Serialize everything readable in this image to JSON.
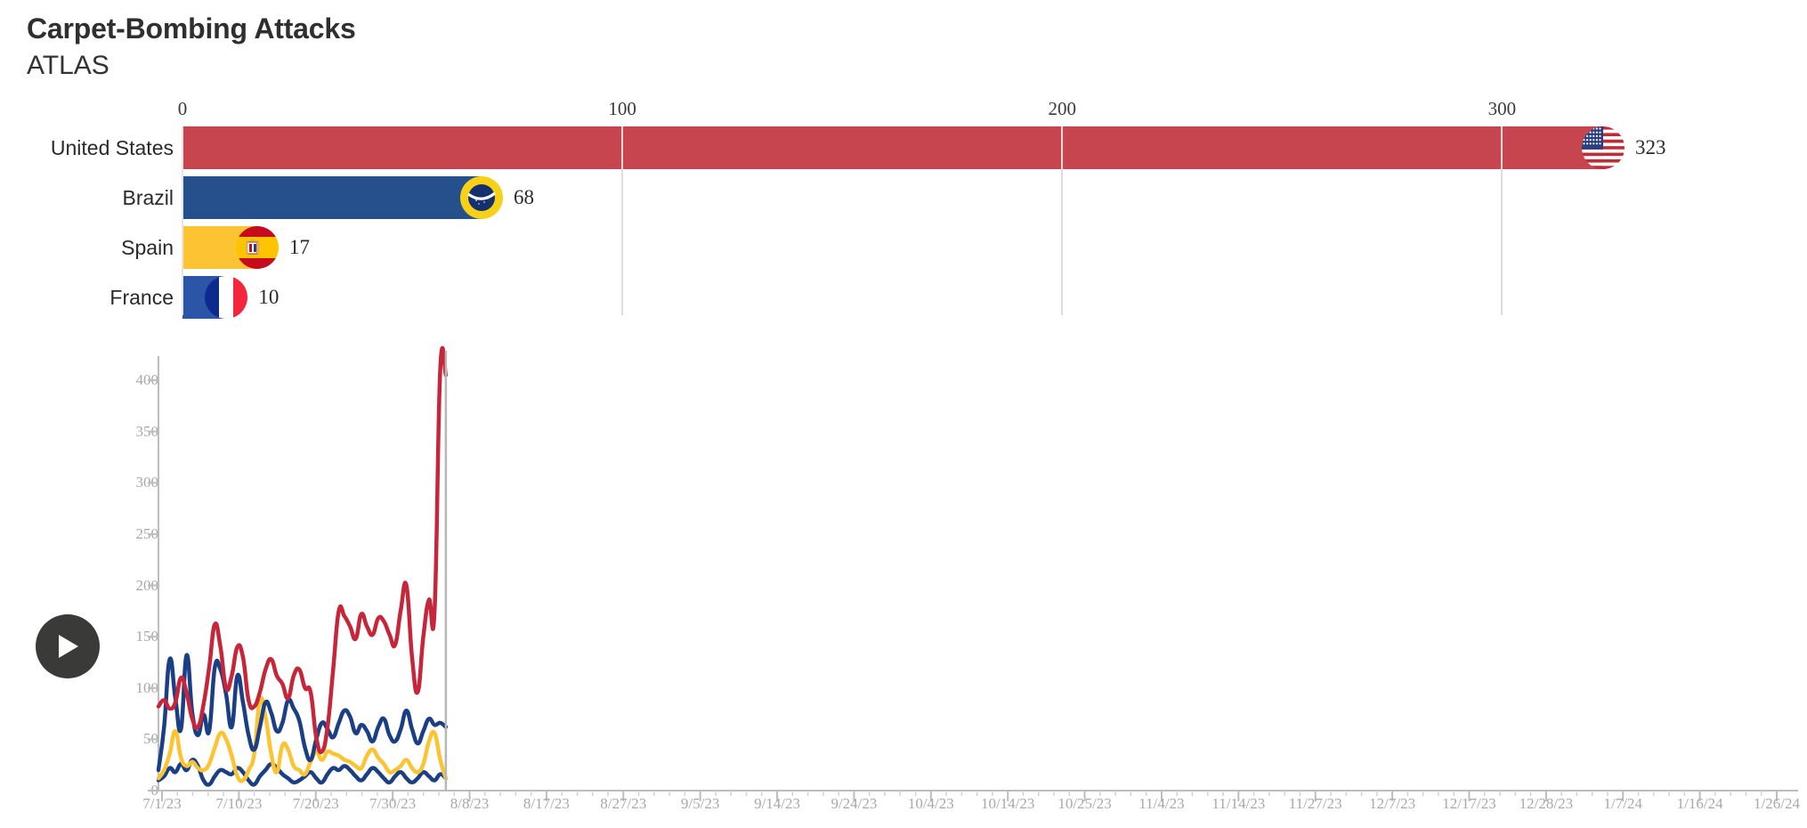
{
  "header": {
    "title": "Carpet-Bombing Attacks",
    "subtitle": "ATLAS"
  },
  "controls": {
    "play_label": "Play",
    "play_icon": "play-icon"
  },
  "bar_chart": {
    "axis_ticks": [
      "0",
      "100",
      "200",
      "300"
    ],
    "axis_max": 340,
    "rows": [
      {
        "label": "United States",
        "value": 323,
        "value_text": "323",
        "color": "#c7454f",
        "flag": "us-flag-icon"
      },
      {
        "label": "Brazil",
        "value": 68,
        "value_text": "68",
        "color": "#26508c",
        "flag": "br-flag-icon"
      },
      {
        "label": "Spain",
        "value": 17,
        "value_text": "17",
        "color": "#fcc433",
        "flag": "es-flag-icon"
      },
      {
        "label": "France",
        "value": 10,
        "value_text": "10",
        "color": "#2b56a8",
        "flag": "fr-flag-icon"
      }
    ]
  },
  "chart_data": {
    "type": "line",
    "title": "Carpet-Bombing Attacks",
    "subtitle": "ATLAS",
    "xlabel": "",
    "ylabel": "",
    "grid": false,
    "legend": "none",
    "ylim": [
      0,
      420
    ],
    "yticks": [
      0,
      50,
      100,
      150,
      200,
      250,
      300,
      350,
      400
    ],
    "ytick_labels": [
      "0",
      "50",
      "100",
      "150",
      "200",
      "250",
      "300",
      "350",
      "400"
    ],
    "xtick_labels": [
      "7/1/23",
      "7/10/23",
      "7/20/23",
      "7/30/23",
      "8/8/23",
      "8/17/23",
      "8/27/23",
      "9/5/23",
      "9/14/23",
      "9/24/23",
      "10/4/23",
      "10/14/23",
      "10/25/23",
      "11/4/23",
      "11/14/23",
      "11/27/23",
      "12/7/23",
      "12/17/23",
      "12/28/23",
      "1/7/24",
      "1/16/24",
      "1/26/24"
    ],
    "x_domain": [
      "7/1/23",
      "1/31/24"
    ],
    "cursor_date": "8/8/23",
    "cursor_x_fraction": 0.178,
    "series": [
      {
        "name": "United States",
        "color": "#c7253a",
        "values": [
          82,
          88,
          80,
          86,
          110,
          95,
          70,
          62,
          84,
          120,
          162,
          140,
          100,
          112,
          140,
          130,
          88,
          82,
          96,
          118,
          128,
          112,
          104,
          90,
          112,
          118,
          100,
          96,
          52,
          38,
          62,
          118,
          175,
          170,
          160,
          148,
          172,
          160,
          152,
          168,
          165,
          152,
          142,
          176,
          200,
          130,
          96,
          150,
          186,
          176,
          410,
          405
        ]
      },
      {
        "name": "Brazil",
        "color": "#1b3f84",
        "values": [
          20,
          62,
          128,
          90,
          60,
          132,
          76,
          54,
          74,
          58,
          120,
          118,
          94,
          62,
          112,
          86,
          54,
          40,
          62,
          86,
          76,
          58,
          66,
          88,
          80,
          68,
          42,
          30,
          50,
          66,
          60,
          52,
          66,
          78,
          72,
          56,
          64,
          58,
          48,
          62,
          70,
          54,
          48,
          60,
          78,
          60,
          46,
          58,
          70,
          64,
          66,
          62
        ]
      },
      {
        "name": "Spain",
        "color": "#fcc433",
        "values": [
          12,
          20,
          36,
          58,
          32,
          24,
          28,
          22,
          20,
          26,
          42,
          56,
          50,
          34,
          14,
          10,
          20,
          36,
          88,
          72,
          36,
          18,
          44,
          40,
          24,
          20,
          16,
          28,
          38,
          30,
          38,
          36,
          34,
          30,
          28,
          24,
          22,
          34,
          40,
          32,
          26,
          18,
          20,
          24,
          30,
          22,
          18,
          26,
          48,
          56,
          30,
          12
        ]
      },
      {
        "name": "France",
        "color": "#1b3f84",
        "values": [
          10,
          14,
          22,
          18,
          26,
          20,
          30,
          24,
          10,
          6,
          14,
          20,
          18,
          16,
          22,
          18,
          10,
          6,
          14,
          20,
          26,
          22,
          16,
          12,
          8,
          10,
          14,
          18,
          12,
          8,
          16,
          22,
          20,
          24,
          20,
          14,
          10,
          16,
          22,
          18,
          12,
          8,
          14,
          18,
          12,
          8,
          12,
          18,
          14,
          10,
          16,
          12
        ]
      }
    ]
  }
}
